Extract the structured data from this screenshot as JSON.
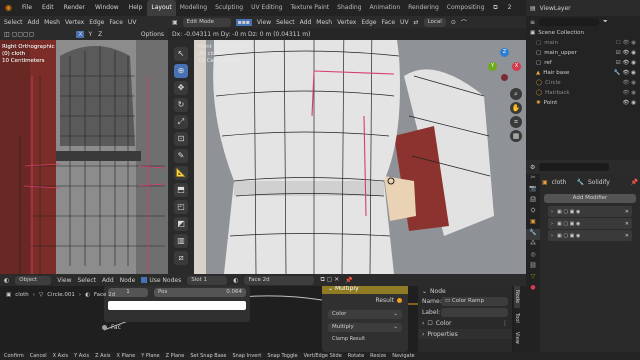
{
  "topbar": {
    "menus": [
      "File",
      "Edit",
      "Render",
      "Window",
      "Help"
    ],
    "workspaces": [
      "Layout",
      "Modeling",
      "Sculpting",
      "UV Editing",
      "Texture Paint",
      "Shading",
      "Animation",
      "Rendering",
      "Compositing"
    ],
    "active_workspace": "Layout",
    "scene_count": "2",
    "view_layer": "ViewLayer"
  },
  "left_viewport": {
    "menu": [
      "Select",
      "Add",
      "Mesh",
      "Vertex",
      "Edge",
      "Face",
      "UV"
    ],
    "options_label": "Options",
    "overlay": [
      "Right Orthographic",
      "(0) cloth",
      "10 Centimeters"
    ]
  },
  "main_viewport": {
    "mode": "Edit Mode",
    "menu": [
      "View",
      "Select",
      "Add",
      "Mesh",
      "Vertex",
      "Edge",
      "Face",
      "UV"
    ],
    "transform_orientation": "Local",
    "status_line": "Dx: -0.04311 m  Dy: -0 m  Dz: 0 m (0.04311 m)",
    "overlay": [
      "Front Orthographic",
      "(0) cloth",
      "10 Centimeters"
    ],
    "gizmo": {
      "x": "X",
      "y": "Y",
      "z": "Z"
    }
  },
  "outliner": {
    "title": "Scene Collection",
    "items": [
      {
        "name": "main",
        "indent": 1
      },
      {
        "name": "main_upper",
        "indent": 1
      },
      {
        "name": "ref",
        "indent": 1
      },
      {
        "name": "Hair base",
        "indent": 1
      },
      {
        "name": "Circle",
        "indent": 1
      },
      {
        "name": "Hairback",
        "indent": 1
      },
      {
        "name": "Point",
        "indent": 1
      }
    ]
  },
  "properties": {
    "object": "cloth",
    "modifier_stack_label": "Solidify",
    "add_modifier": "Add Modifier"
  },
  "node_editor": {
    "object_label": "Object",
    "menus": [
      "View",
      "Select",
      "Add",
      "Node"
    ],
    "use_nodes": "Use Nodes",
    "slot": "Slot 1",
    "material": "Face 2d",
    "breadcrumb": [
      "cloth",
      "Circle.001",
      "Face 2d"
    ],
    "value_node": {
      "pos_label": "Pos",
      "pos_value": "0.064",
      "fac_label": "Fac"
    },
    "math_node": {
      "title": "Multiply",
      "result": "Result",
      "color_label": "Color",
      "multiply_label": "Multiply",
      "clamp_label": "Clamp Result"
    },
    "side_panel": {
      "section": "Node",
      "name_label": "Name:",
      "name_value": "Color Ramp",
      "label_label": "Label:",
      "color_label": "Color",
      "properties_label": "Properties"
    },
    "tabs": [
      "Node",
      "Tool",
      "View"
    ]
  },
  "statusbar": [
    "Confirm",
    "Cancel",
    "X Axis",
    "Y Axis",
    "Z Axis",
    "X Plane",
    "Y Plane",
    "Z Plane",
    "Set Snap Base",
    "Snap Invert",
    "Snap Toggle",
    "Vert/Edge Slide",
    "Rotate",
    "Resize",
    "Navigate"
  ],
  "colors": {
    "accent": "#4772b3",
    "header": "#2b2b2b",
    "panel": "#232323",
    "mesh_seam": "#d63d6a",
    "cloth_red": "#7a2a27",
    "orange_value": "#f0a020"
  }
}
